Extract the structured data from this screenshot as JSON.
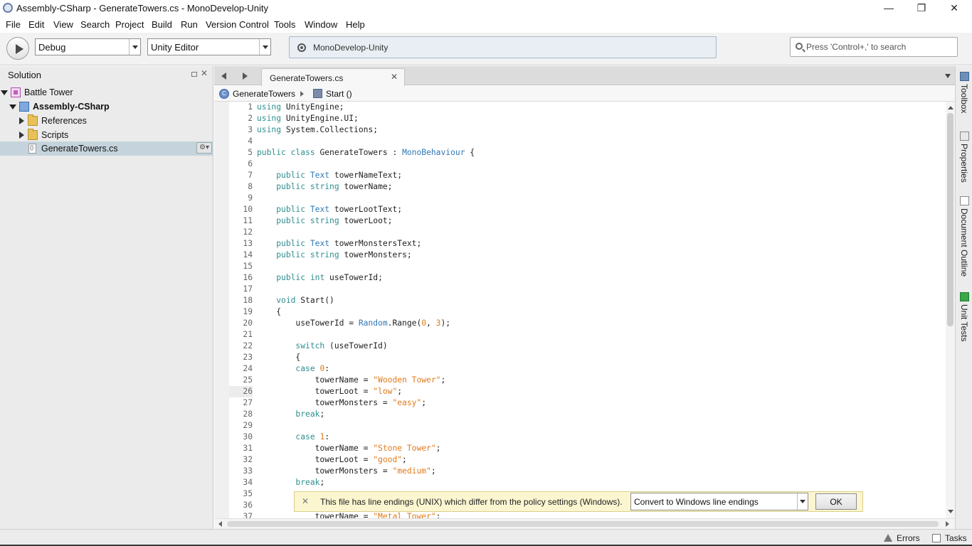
{
  "window": {
    "title": "Assembly-CSharp - GenerateTowers.cs - MonoDevelop-Unity",
    "minimize_glyph": "—",
    "restore_glyph": "❐",
    "close_glyph": "✕"
  },
  "menu": [
    "File",
    "Edit",
    "View",
    "Search",
    "Project",
    "Build",
    "Run",
    "Version Control",
    "Tools",
    "Window",
    "Help"
  ],
  "toolbar": {
    "configuration": "Debug",
    "target": "Unity Editor",
    "status": "MonoDevelop-Unity",
    "search_placeholder": "Press 'Control+,' to search"
  },
  "solution": {
    "title": "Solution",
    "close_glyph": "✕",
    "items": [
      {
        "label": "Battle Tower",
        "icon": "solution-icon",
        "expanded": true
      },
      {
        "label": "Assembly-CSharp",
        "icon": "project-icon",
        "expanded": true
      },
      {
        "label": "References",
        "icon": "folder-icon",
        "expanded": false
      },
      {
        "label": "Scripts",
        "icon": "folder-icon",
        "expanded": false
      },
      {
        "label": "GenerateTowers.cs",
        "icon": "csharp-file-icon",
        "selected": true
      }
    ],
    "gear_glyph": "⚙▾"
  },
  "editor": {
    "tab_label": "GenerateTowers.cs",
    "tab_close_glyph": "✕",
    "breadcrumb_class": "GenerateTowers",
    "breadcrumb_class_glyph": "C",
    "breadcrumb_method": "Start ()",
    "current_line": 26,
    "lines": [
      "using UnityEngine;",
      "using UnityEngine.UI;",
      "using System.Collections;",
      "",
      "public class GenerateTowers : MonoBehaviour {",
      "",
      "    public Text towerNameText;",
      "    public string towerName;",
      "",
      "    public Text towerLootText;",
      "    public string towerLoot;",
      "",
      "    public Text towerMonstersText;",
      "    public string towerMonsters;",
      "",
      "    public int useTowerId;",
      "",
      "    void Start()",
      "    {",
      "        useTowerId = Random.Range(0, 3);",
      "",
      "        switch (useTowerId)",
      "        {",
      "        case 0:",
      "            towerName = \"Wooden Tower\";",
      "            towerLoot = \"low\";",
      "            towerMonsters = \"easy\";",
      "        break;",
      "",
      "        case 1:",
      "            towerName = \"Stone Tower\";",
      "            towerLoot = \"good\";",
      "            towerMonsters = \"medium\";",
      "        break;",
      "",
      "",
      "            towerName = \"Metal Tower\";"
    ]
  },
  "infobar": {
    "close_glyph": "✕",
    "message": "This file has line endings (UNIX) which differ from the policy settings (Windows).",
    "option": "Convert to Windows line endings",
    "ok_label": "OK"
  },
  "right_dock": [
    "Toolbox",
    "Properties",
    "Document Outline",
    "Unit Tests"
  ],
  "statusbar": {
    "errors": "Errors",
    "tasks": "Tasks"
  },
  "colors": {
    "keyword": "#2f8e8e",
    "type": "#2f78b5",
    "string": "#e07a1c",
    "selection": "#c5d4dc",
    "infobar": "#fbf6d0"
  }
}
